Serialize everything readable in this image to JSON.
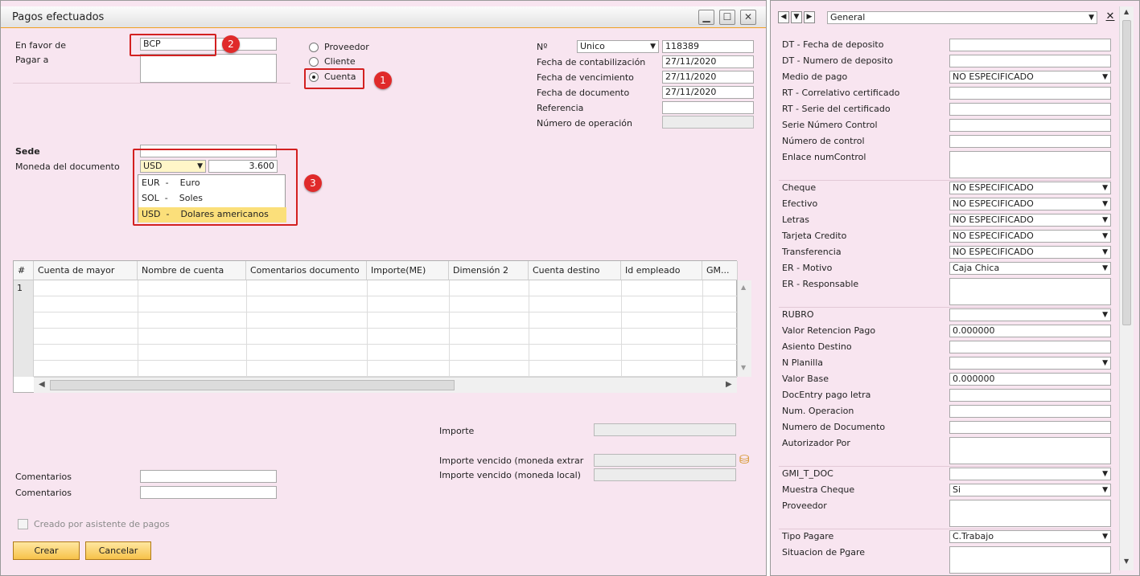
{
  "window": {
    "title": "Pagos efectuados"
  },
  "left_form": {
    "en_favor_label": "En favor de",
    "en_favor_value": "BCP",
    "pagar_a_label": "Pagar a",
    "radio_proveedor": "Proveedor",
    "radio_cliente": "Cliente",
    "radio_cuenta": "Cuenta",
    "sede_label": "Sede",
    "moneda_label": "Moneda del documento",
    "moneda_value": "USD",
    "tipo_cambio": "3.600",
    "moneda_options": [
      {
        "code": "EUR",
        "sep": "-",
        "name": "Euro"
      },
      {
        "code": "SOL",
        "sep": "-",
        "name": "Soles"
      },
      {
        "code": "USD",
        "sep": "-",
        "name": "Dolares americanos"
      }
    ]
  },
  "right_form": {
    "nro_label": "Nº",
    "nro_series": "Unico",
    "nro_value": "118389",
    "fecha_contab_label": "Fecha de contabilización",
    "fecha_contab_value": "27/11/2020",
    "fecha_venc_label": "Fecha de vencimiento",
    "fecha_venc_value": "27/11/2020",
    "fecha_doc_label": "Fecha de documento",
    "fecha_doc_value": "27/11/2020",
    "referencia_label": "Referencia",
    "num_operacion_label": "Número de operación"
  },
  "badges": [
    "1",
    "2",
    "3"
  ],
  "grid": {
    "columns": [
      "#",
      "Cuenta de mayor",
      "Nombre de cuenta",
      "Comentarios documento",
      "Importe(ME)",
      "Dimensión 2",
      "Cuenta destino",
      "Id empleado",
      "GM..."
    ],
    "first_row_num": "1"
  },
  "totals": {
    "importe_label": "Importe",
    "importe_vencido_extr_label": "Importe vencido (moneda extrar",
    "importe_vencido_local_label": "Importe vencido (moneda local)"
  },
  "footer": {
    "comentarios1_label": "Comentarios",
    "comentarios2_label": "Comentarios",
    "creado_label": "Creado por asistente de pagos",
    "crear_button": "Crear",
    "cancelar_button": "Cancelar"
  },
  "panel": {
    "selector": "General",
    "fields": [
      {
        "label": "DT - Fecha de deposito",
        "value": ""
      },
      {
        "label": "DT - Numero de deposito",
        "value": ""
      },
      {
        "label": "Medio de pago",
        "value": "NO ESPECIFICADO"
      },
      {
        "label": "RT - Correlativo certificado",
        "value": ""
      },
      {
        "label": "RT - Serie del certificado",
        "value": ""
      },
      {
        "label": "Serie Número Control",
        "value": ""
      },
      {
        "label": "Número de control",
        "value": ""
      },
      {
        "label": "Enlace numControl",
        "value": ""
      },
      {
        "label": "Cheque",
        "value": "NO ESPECIFICADO"
      },
      {
        "label": "Efectivo",
        "value": "NO ESPECIFICADO"
      },
      {
        "label": "Letras",
        "value": "NO ESPECIFICADO"
      },
      {
        "label": "Tarjeta Credito",
        "value": "NO ESPECIFICADO"
      },
      {
        "label": "Transferencia",
        "value": "NO ESPECIFICADO"
      },
      {
        "label": "ER - Motivo",
        "value": "Caja Chica"
      },
      {
        "label": "ER - Responsable",
        "value": ""
      },
      {
        "label": "RUBRO",
        "value": ""
      },
      {
        "label": "Valor Retencion Pago",
        "value": "0.000000"
      },
      {
        "label": "Asiento Destino",
        "value": ""
      },
      {
        "label": "N Planilla",
        "value": ""
      },
      {
        "label": "Valor Base",
        "value": "0.000000"
      },
      {
        "label": "DocEntry pago letra",
        "value": ""
      },
      {
        "label": "Num. Operacion",
        "value": ""
      },
      {
        "label": "Numero de Documento",
        "value": ""
      },
      {
        "label": "Autorizador Por",
        "value": ""
      },
      {
        "label": "GMI_T_DOC",
        "value": ""
      },
      {
        "label": "Muestra Cheque",
        "value": "Si"
      },
      {
        "label": "Proveedor",
        "value": ""
      },
      {
        "label": "Tipo Pagare",
        "value": "C.Trabajo"
      },
      {
        "label": "Situacion de Pgare",
        "value": ""
      }
    ]
  }
}
